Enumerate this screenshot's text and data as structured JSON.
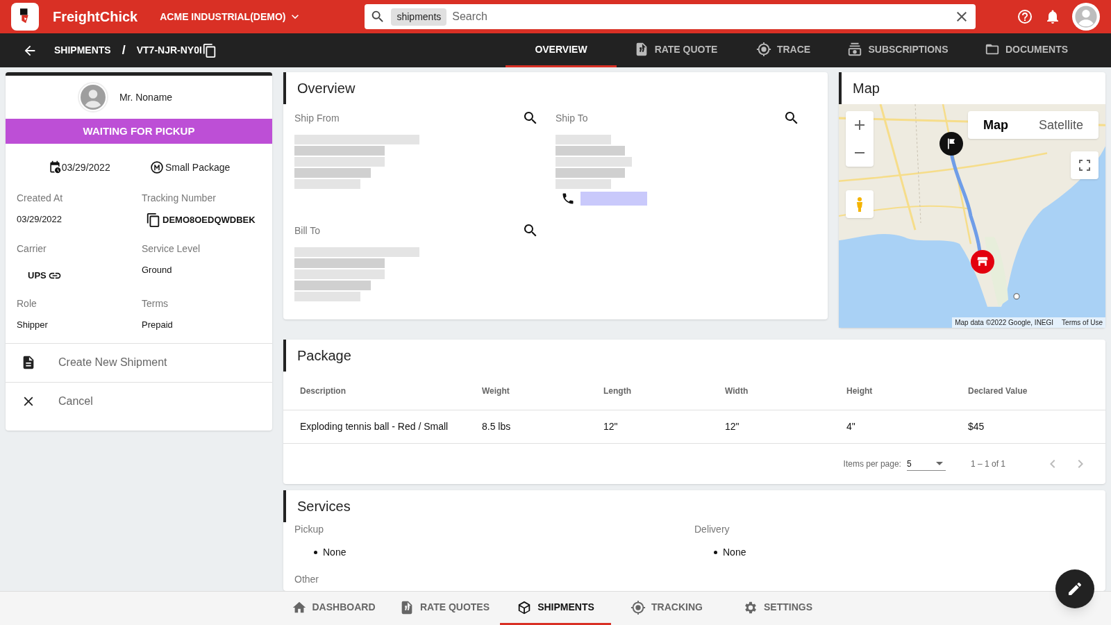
{
  "app": {
    "name": "FreightChick",
    "org": "ACME INDUSTRIAL(DEMO)"
  },
  "search": {
    "chip": "shipments",
    "placeholder": "Search"
  },
  "breadcrumb": {
    "parent": "SHIPMENTS",
    "separator": "/",
    "current": "VT7-NJR-NY0I"
  },
  "tabs": [
    {
      "label": "OVERVIEW",
      "selected": true
    },
    {
      "label": "RATE QUOTE",
      "selected": false
    },
    {
      "label": "TRACE",
      "selected": false
    },
    {
      "label": "SUBSCRIPTIONS",
      "selected": false
    },
    {
      "label": "DOCUMENTS",
      "selected": false
    }
  ],
  "contact": {
    "name": "Mr. Noname"
  },
  "status": {
    "label": "WAITING FOR PICKUP"
  },
  "summary": {
    "date": "03/29/2022",
    "mode": "Small Package"
  },
  "fields": [
    {
      "label": "Created At",
      "value": "03/29/2022",
      "kind": "text"
    },
    {
      "label": "Tracking Number",
      "value": "DEMO8OEDQWDBEK",
      "kind": "copy"
    },
    {
      "label": "Carrier",
      "value": "UPS",
      "kind": "link"
    },
    {
      "label": "Service Level",
      "value": "Ground",
      "kind": "text"
    },
    {
      "label": "Role",
      "value": "Shipper",
      "kind": "text"
    },
    {
      "label": "Terms",
      "value": "Prepaid",
      "kind": "text"
    }
  ],
  "actions": [
    {
      "label": "Create New Shipment"
    },
    {
      "label": "Cancel"
    }
  ],
  "overview": {
    "title": "Overview",
    "sections": [
      {
        "label": "Ship From",
        "phone": false
      },
      {
        "label": "Ship To",
        "phone": true
      },
      {
        "label": "Bill To",
        "phone": false
      }
    ]
  },
  "map": {
    "title": "Map",
    "map_types": [
      {
        "label": "Map",
        "selected": true
      },
      {
        "label": "Satellite",
        "selected": false
      }
    ],
    "attribution": "Map data ©2022 Google, INEGI",
    "terms": "Terms of Use"
  },
  "package": {
    "title": "Package",
    "columns": [
      "Description",
      "Weight",
      "Length",
      "Width",
      "Height",
      "Declared Value"
    ],
    "rows": [
      [
        "Exploding tennis ball - Red / Small",
        "8.5 lbs",
        "12\"",
        "12\"",
        "4\"",
        "$45"
      ]
    ],
    "items_per_page_label": "Items per page:",
    "items_per_page": "5",
    "range": "1 – 1 of 1"
  },
  "services": {
    "title": "Services",
    "groups": [
      {
        "label": "Pickup",
        "items": [
          "None"
        ]
      },
      {
        "label": "Delivery",
        "items": [
          "None"
        ]
      }
    ],
    "other_label": "Other"
  },
  "bottom_nav": [
    {
      "label": "DASHBOARD",
      "selected": false
    },
    {
      "label": "RATE QUOTES",
      "selected": false
    },
    {
      "label": "SHIPMENTS",
      "selected": true
    },
    {
      "label": "TRACKING",
      "selected": false
    },
    {
      "label": "SETTINGS",
      "selected": false
    }
  ]
}
